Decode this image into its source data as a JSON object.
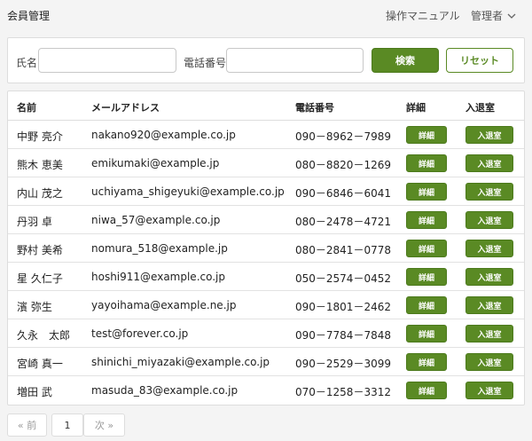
{
  "header": {
    "title": "会員管理",
    "manual": "操作マニュアル",
    "admin": "管理者"
  },
  "search": {
    "name_label": "氏名",
    "phone_label": "電話番号",
    "name_value": "",
    "phone_value": "",
    "search_button": "検索",
    "reset_button": "リセット"
  },
  "table": {
    "headers": {
      "name": "名前",
      "email": "メールアドレス",
      "phone": "電話番号",
      "detail": "詳細",
      "room": "入退室"
    },
    "detail_button": "詳細",
    "room_button": "入退室",
    "rows": [
      {
        "name": "中野 亮介",
        "email": "nakano920@example.co.jp",
        "phone": "090－8962－7989"
      },
      {
        "name": "熊木 恵美",
        "email": "emikumaki@example.jp",
        "phone": "080－8820－1269"
      },
      {
        "name": "内山 茂之",
        "email": "uchiyama_shigeyuki@example.co.jp",
        "phone": "090－6846－6041"
      },
      {
        "name": "丹羽 卓",
        "email": "niwa_57@example.co.jp",
        "phone": "080－2478－4721"
      },
      {
        "name": "野村 美希",
        "email": "nomura_518@example.jp",
        "phone": "080－2841－0778"
      },
      {
        "name": "星 久仁子",
        "email": "hoshi911@example.co.jp",
        "phone": "050－2574－0452"
      },
      {
        "name": "濱 弥生",
        "email": "yayoihama@example.ne.jp",
        "phone": "090－1801－2462"
      },
      {
        "name": "久永　太郎",
        "email": "test@forever.co.jp",
        "phone": "090－7784－7848"
      },
      {
        "name": "宮崎 真一",
        "email": "shinichi_miyazaki@example.co.jp",
        "phone": "090－2529－3099"
      },
      {
        "name": "増田 武",
        "email": "masuda_83@example.co.jp",
        "phone": "070－1258－3312"
      }
    ]
  },
  "pagination": {
    "prev": "« 前",
    "page": "1",
    "next": "次 »"
  },
  "colors": {
    "accent": "#5a8a24",
    "background": "#f4f4f4"
  }
}
